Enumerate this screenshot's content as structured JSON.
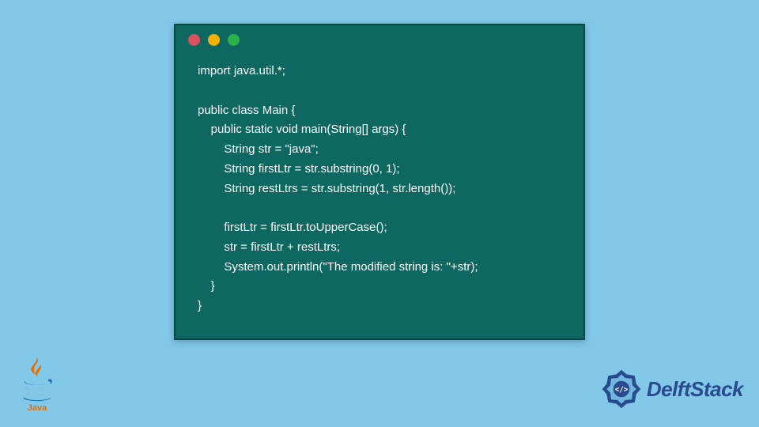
{
  "window": {
    "dots": [
      "red",
      "yellow",
      "green"
    ]
  },
  "code": {
    "lines": [
      "import java.util.*;",
      "",
      "public class Main {",
      "    public static void main(String[] args) {",
      "        String str = \"java\";",
      "        String firstLtr = str.substring(0, 1);",
      "        String restLtrs = str.substring(1, str.length());",
      "",
      "        firstLtr = firstLtr.toUpperCase();",
      "        str = firstLtr + restLtrs;",
      "        System.out.println(\"The modified string is: \"+str);",
      "    }",
      "}"
    ]
  },
  "brand": {
    "name": "DelftStack"
  },
  "logos": {
    "java_label": "Java"
  },
  "colors": {
    "background": "#82c8e8",
    "window_bg": "#0e6760",
    "window_border": "#0a4a45",
    "code_text": "#ffffff",
    "brand_text": "#2b4a8e",
    "java_orange": "#e76f00",
    "java_blue": "#0d6db6"
  }
}
